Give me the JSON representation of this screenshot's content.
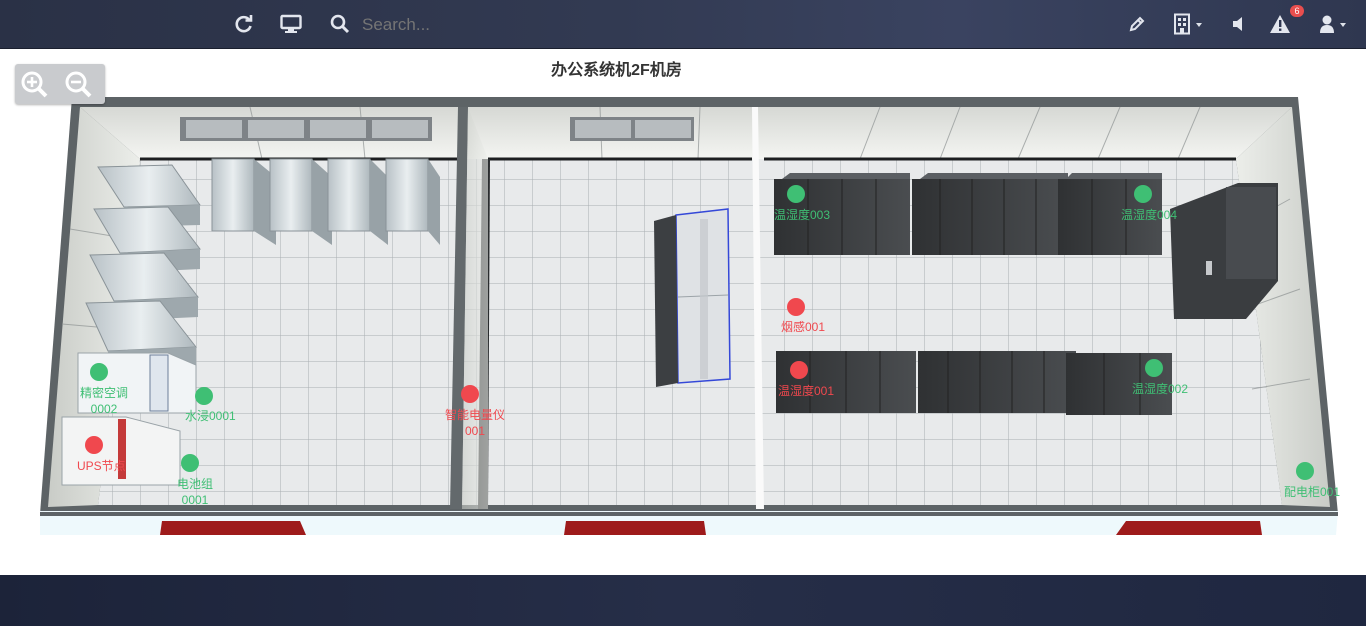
{
  "topbar": {
    "search_placeholder": "Search...",
    "alert_count": "6",
    "icons": [
      "refresh-icon",
      "monitor-icon",
      "search-icon",
      "pencil-icon",
      "building-icon",
      "speaker-icon",
      "warning-icon",
      "user-icon"
    ]
  },
  "page": {
    "title": "办公系统机2F机房"
  },
  "zoom": {
    "icons": [
      "zoom-in-icon",
      "zoom-out-icon"
    ]
  },
  "colors": {
    "ok": "#3fbf74",
    "alarm": "#f0484e",
    "badge": "#e84e4e"
  },
  "sensors": [
    {
      "id": "s1",
      "label": "温湿度003",
      "status": "ok"
    },
    {
      "id": "s2",
      "label": "温湿度004",
      "status": "ok"
    },
    {
      "id": "s3",
      "label": "烟感001",
      "status": "alarm"
    },
    {
      "id": "s4",
      "label": "温湿度001",
      "status": "alarm"
    },
    {
      "id": "s5",
      "label": "温湿度002",
      "status": "ok"
    },
    {
      "id": "s6",
      "label": "精密空调",
      "label2": "0002",
      "status": "ok"
    },
    {
      "id": "s7",
      "label": "水浸0001",
      "status": "ok"
    },
    {
      "id": "s8",
      "label": "智能电量仪",
      "label2": "001",
      "status": "alarm"
    },
    {
      "id": "s9",
      "label": "UPS节点",
      "status": "alarm"
    },
    {
      "id": "s10",
      "label": "电池组",
      "label2": "0001",
      "status": "ok"
    },
    {
      "id": "s11",
      "label": "配电柜001",
      "status": "ok"
    }
  ]
}
